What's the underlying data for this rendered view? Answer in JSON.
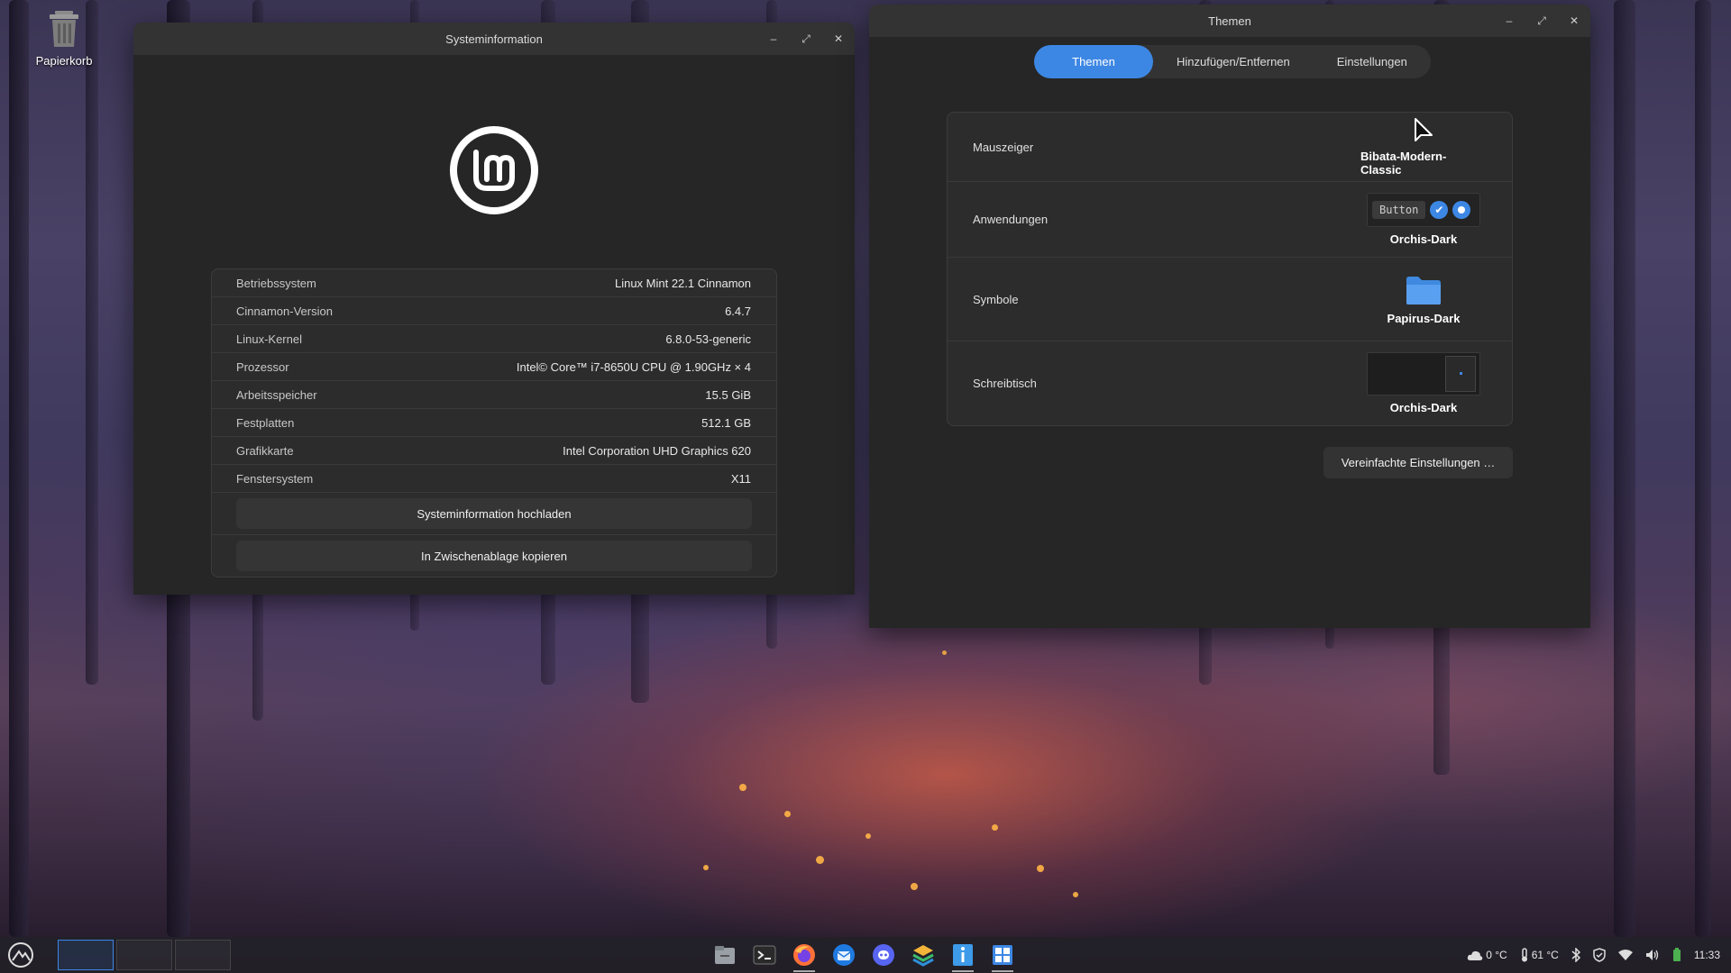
{
  "desktop": {
    "trash_label": "Papierkorb"
  },
  "sysinfo_window": {
    "title": "Systeminformation",
    "rows": [
      {
        "key": "Betriebssystem",
        "value": "Linux Mint 22.1 Cinnamon"
      },
      {
        "key": "Cinnamon-Version",
        "value": "6.4.7"
      },
      {
        "key": "Linux-Kernel",
        "value": "6.8.0-53-generic"
      },
      {
        "key": "Prozessor",
        "value": "Intel© Core™ i7-8650U CPU @ 1.90GHz × 4"
      },
      {
        "key": "Arbeitsspeicher",
        "value": "15.5 GiB"
      },
      {
        "key": "Festplatten",
        "value": "512.1 GB"
      },
      {
        "key": "Grafikkarte",
        "value": "Intel Corporation UHD Graphics 620"
      },
      {
        "key": "Fenstersystem",
        "value": "X11"
      }
    ],
    "upload_button": "Systeminformation hochladen",
    "copy_button": "In Zwischenablage kopieren"
  },
  "themes_window": {
    "title": "Themen",
    "tabs": [
      "Themen",
      "Hinzufügen/Entfernen",
      "Einstellungen"
    ],
    "active_tab": "Themen",
    "rows": [
      {
        "label": "Mauszeiger",
        "value": "Bibata-Modern-Classic"
      },
      {
        "label": "Anwendungen",
        "value": "Orchis-Dark",
        "preview_button": "Button"
      },
      {
        "label": "Symbole",
        "value": "Papirus-Dark"
      },
      {
        "label": "Schreibtisch",
        "value": "Orchis-Dark"
      }
    ],
    "simple_settings_button": "Vereinfachte Einstellungen …"
  },
  "taskbar": {
    "launchers": [
      "files-icon",
      "terminal-icon",
      "firefox-icon",
      "thunderbird-icon",
      "discord-icon",
      "layers-icon",
      "sysinfo-icon",
      "themes-icon"
    ],
    "weather_temp": "0 °C",
    "cpu_temp": "61 °C",
    "clock": "11:33"
  },
  "colors": {
    "accent": "#3d87e4",
    "window_bg": "#262626",
    "titlebar_bg": "#333333"
  }
}
